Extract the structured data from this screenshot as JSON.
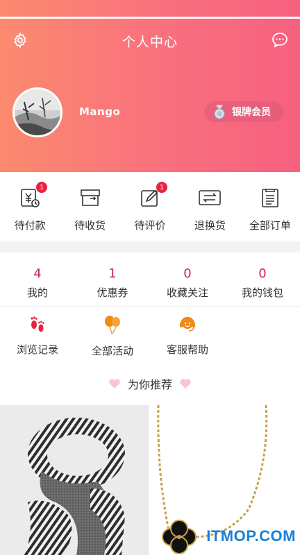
{
  "header": {
    "title": "个人中心",
    "username": "Mango",
    "member_label": "银牌会员",
    "gradient_start": "#fb8a6e",
    "gradient_end": "#f6607f"
  },
  "icons": {
    "settings": "gear-icon",
    "message": "chat-bubble-icon"
  },
  "orders": [
    {
      "label": "待付款",
      "icon": "payment-icon",
      "badge": "1"
    },
    {
      "label": "待收货",
      "icon": "box-icon",
      "badge": ""
    },
    {
      "label": "待评价",
      "icon": "edit-icon",
      "badge": "1"
    },
    {
      "label": "退换货",
      "icon": "exchange-icon",
      "badge": ""
    },
    {
      "label": "全部订单",
      "icon": "list-icon",
      "badge": ""
    }
  ],
  "stats": [
    {
      "num": "4",
      "label": "我的"
    },
    {
      "num": "1",
      "label": "优惠券"
    },
    {
      "num": "0",
      "label": "收藏关注"
    },
    {
      "num": "0",
      "label": "我的钱包"
    }
  ],
  "tools": [
    {
      "label": "浏览记录",
      "icon": "footprints-icon"
    },
    {
      "label": "全部活动",
      "icon": "balloons-icon"
    },
    {
      "label": "客服帮助",
      "icon": "headset-icon"
    }
  ],
  "recommend": {
    "label": "为你推荐"
  },
  "watermark": "ITMOP.COM",
  "colors": {
    "accent_red": "#c8264a",
    "badge_red": "#e8233f",
    "footprint_red": "#e8233f",
    "orange": "#f08a10"
  }
}
